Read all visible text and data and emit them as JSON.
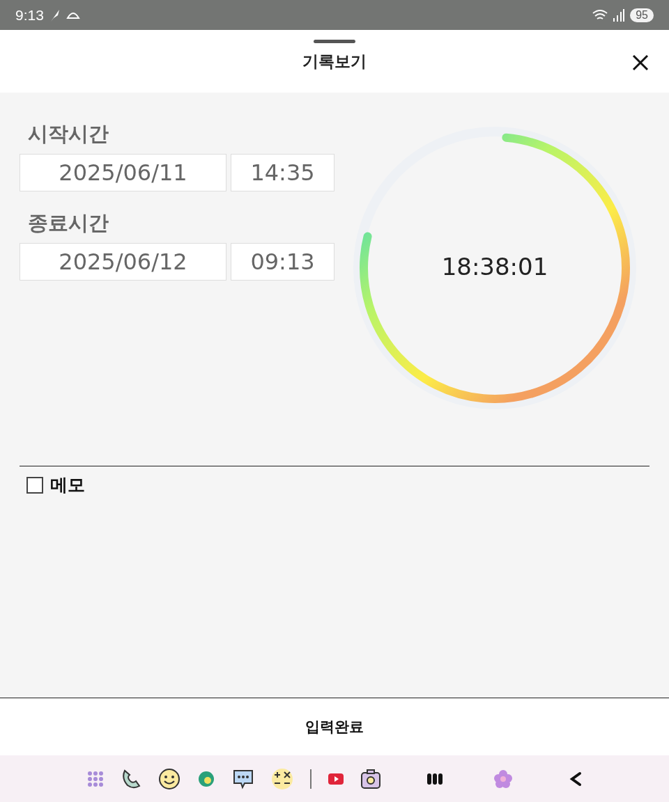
{
  "status_bar": {
    "time": "9:13",
    "battery": "95"
  },
  "header": {
    "title": "기록보기"
  },
  "times": [
    {
      "label": "시작시간",
      "date": "2025/06/11",
      "time": "14:35"
    },
    {
      "label": "종료시간",
      "date": "2025/06/12",
      "time": "09:13"
    }
  ],
  "timer": {
    "elapsed": "18:38:01",
    "level": 0.775
  },
  "memo": {
    "label": "메모",
    "checked": false
  },
  "submit": {
    "label": "입력완료"
  }
}
